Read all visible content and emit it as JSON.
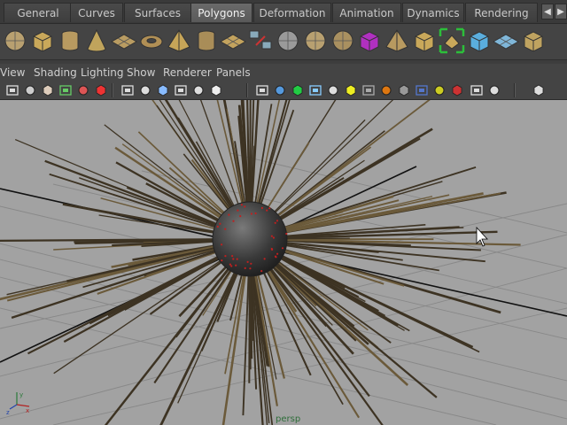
{
  "tabs": [
    {
      "label": "General",
      "active": false
    },
    {
      "label": "Curves",
      "active": false
    },
    {
      "label": "Surfaces",
      "active": false
    },
    {
      "label": "Polygons",
      "active": true
    },
    {
      "label": "Deformation",
      "active": false
    },
    {
      "label": "Animation",
      "active": false
    },
    {
      "label": "Dynamics",
      "active": false
    },
    {
      "label": "Rendering",
      "active": false
    }
  ],
  "tab_scroll": {
    "left_icon": "arrow-left-icon",
    "right_icon": "arrow-right-icon"
  },
  "shelf_icons": [
    "poly-sphere-icon",
    "poly-cube-icon",
    "poly-cylinder-icon",
    "poly-cone-icon",
    "poly-plane-icon",
    "poly-torus-icon",
    "poly-pyramid-icon",
    "poly-pipe-icon",
    "combine-icon",
    "separate-icon",
    "extract-icon",
    "smooth-icon",
    "booleans-icon",
    "mirror-icon",
    "extrude-icon",
    "bridge-icon",
    "append-polygon-icon",
    "split-polygon-icon",
    "bevel-icon",
    "soften-edge-icon"
  ],
  "menu": [
    "View",
    "Shading",
    "Lighting",
    "Show",
    "Renderer",
    "Panels"
  ],
  "viewport_icons": [
    "select-camera-icon",
    "camera-attributes-icon",
    "bookmarks-icon",
    "image-plane-icon",
    "2d-pan-zoom-icon",
    "grease-pencil-icon",
    "grid-icon",
    "film-gate-icon",
    "resolution-gate-icon",
    "gate-mask-icon",
    "field-chart-icon",
    "safe-action-icon",
    "wireframe-icon",
    "smooth-shade-icon",
    "wireframe-on-shaded-icon",
    "xray-icon",
    "textured-icon",
    "use-all-lights-icon",
    "shadows-icon",
    "screen-space-ao-icon",
    "motion-blur-icon",
    "multisample-aa-icon",
    "depth-of-field-icon",
    "isolate-select-icon",
    "xray-joints-icon",
    "xray-active-components-icon",
    "hypershade-icon"
  ],
  "viewport": {
    "camera_label": "persp",
    "background_color": "#a2a2a2",
    "grid_color": "#888888",
    "axis_color": "#111111",
    "object_color": "#3d3323"
  }
}
